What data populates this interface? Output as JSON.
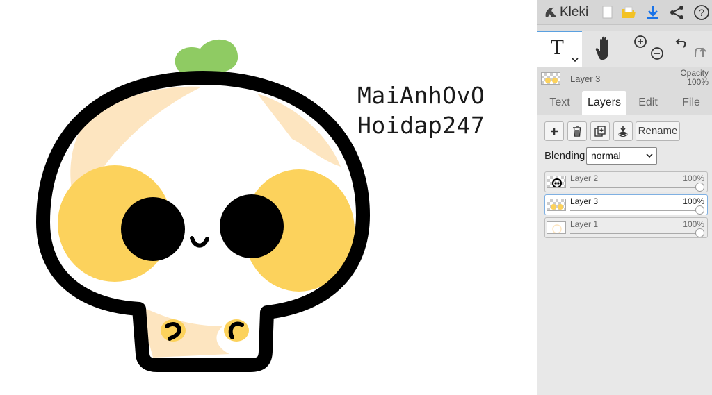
{
  "app": {
    "name": "Kleki"
  },
  "colors": {
    "accent": "#5aa0e0",
    "download": "#1a73e8",
    "folder": "#f3c224"
  },
  "toolbar": {
    "icons": [
      "new-image-icon",
      "open-folder-icon",
      "download-icon",
      "share-icon",
      "help-icon"
    ]
  },
  "tools": {
    "text_glyph": "T",
    "items": [
      "text-tool-icon",
      "hand-tool-icon",
      "zoom-in-icon",
      "zoom-out-icon",
      "undo-icon",
      "redo-icon"
    ]
  },
  "active_layer": {
    "name": "Layer 3",
    "opacity_label": "Opacity",
    "opacity_value": "100%"
  },
  "tabs": [
    {
      "label": "Text",
      "active": false
    },
    {
      "label": "Layers",
      "active": true
    },
    {
      "label": "Edit",
      "active": false
    },
    {
      "label": "File",
      "active": false
    }
  ],
  "layer_actions": {
    "icons": [
      "add-layer-icon",
      "delete-layer-icon",
      "duplicate-layer-icon",
      "merge-down-icon"
    ],
    "rename_label": "Rename"
  },
  "blending": {
    "label": "Blending",
    "value": "normal"
  },
  "layers": [
    {
      "name": "Layer 2",
      "opacity": "100%",
      "opacity_fraction": 1.0,
      "selected": false
    },
    {
      "name": "Layer 3",
      "opacity": "100%",
      "opacity_fraction": 1.0,
      "selected": true
    },
    {
      "name": "Layer 1",
      "opacity": "100%",
      "opacity_fraction": 1.0,
      "selected": false
    }
  ],
  "canvas": {
    "text_lines": [
      "MaiAnhOvO",
      "Hoidap247"
    ],
    "artwork": "skull-character-illustration",
    "artwork_colors": {
      "outline": "#000000",
      "cheeks": "#fcd25c",
      "sprout": "#8fcb63",
      "shade": "#fde5c0"
    }
  }
}
